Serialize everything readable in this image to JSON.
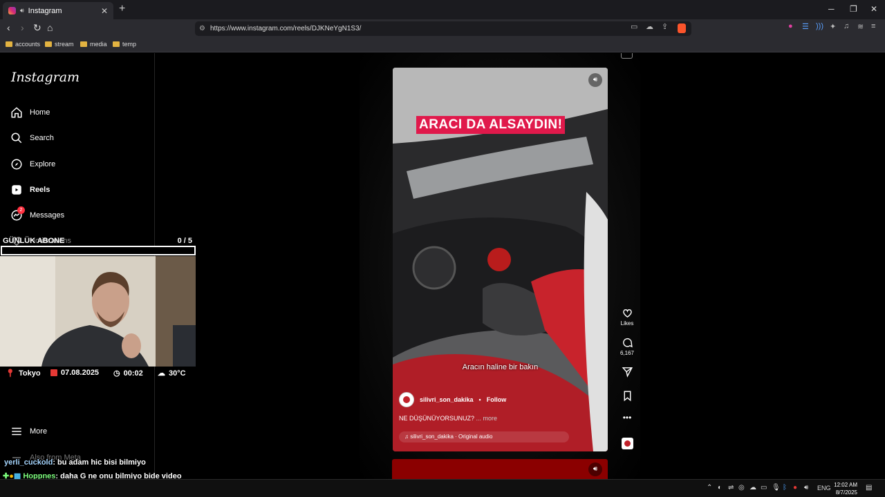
{
  "browser": {
    "tab_title": "Instagram",
    "url": "https://www.instagram.com/reels/DJKNeYgN1S3/",
    "bookmarks": [
      "accounts",
      "stream",
      "media",
      "temp"
    ]
  },
  "sidebar": {
    "logo": "Instagram",
    "items": [
      {
        "label": "Home"
      },
      {
        "label": "Search"
      },
      {
        "label": "Explore"
      },
      {
        "label": "Reels"
      },
      {
        "label": "Messages",
        "badge": "2"
      },
      {
        "label": "Notifications"
      }
    ],
    "more_label": "More",
    "also_from_meta": "Also from Meta"
  },
  "overlay": {
    "subgoal_title": "GÜNLÜK ABONE",
    "subgoal_count": "0 / 5",
    "subgoal_progress": 0,
    "location": "Tokyo",
    "date": "07.08.2025",
    "time": "00:02",
    "weather": "30°C",
    "chat": [
      {
        "user": "yerli_cuckold",
        "message": ": bu adam hic bisi bilmiyo",
        "color": "#a6d6ff"
      },
      {
        "user": "Hoppnes",
        "message": ": daha G ne onu bilmiyo bide video cekmis aq",
        "color": "#7cfc7c"
      }
    ]
  },
  "reel": {
    "headline": "ARACI DA ALSAYDIN!",
    "subtitle": "Aracın haline bir bakın",
    "author": "silivri_son_dakika",
    "follow_label": "Follow",
    "description": "NE DÜŞÜNÜYORSUNUZ?",
    "more_label": "... more",
    "audio": "silivri_son_dakika · Original audio",
    "likes_label": "Likes",
    "comments_count": "6,167"
  },
  "taskbar": {
    "language": "ENG",
    "clock_time": "12:02 AM",
    "clock_date": "8/7/2025"
  },
  "colors": {
    "headline_bg": "#e0194b",
    "notification_badge": "#ff3040",
    "next_reel": "#8b0000"
  }
}
